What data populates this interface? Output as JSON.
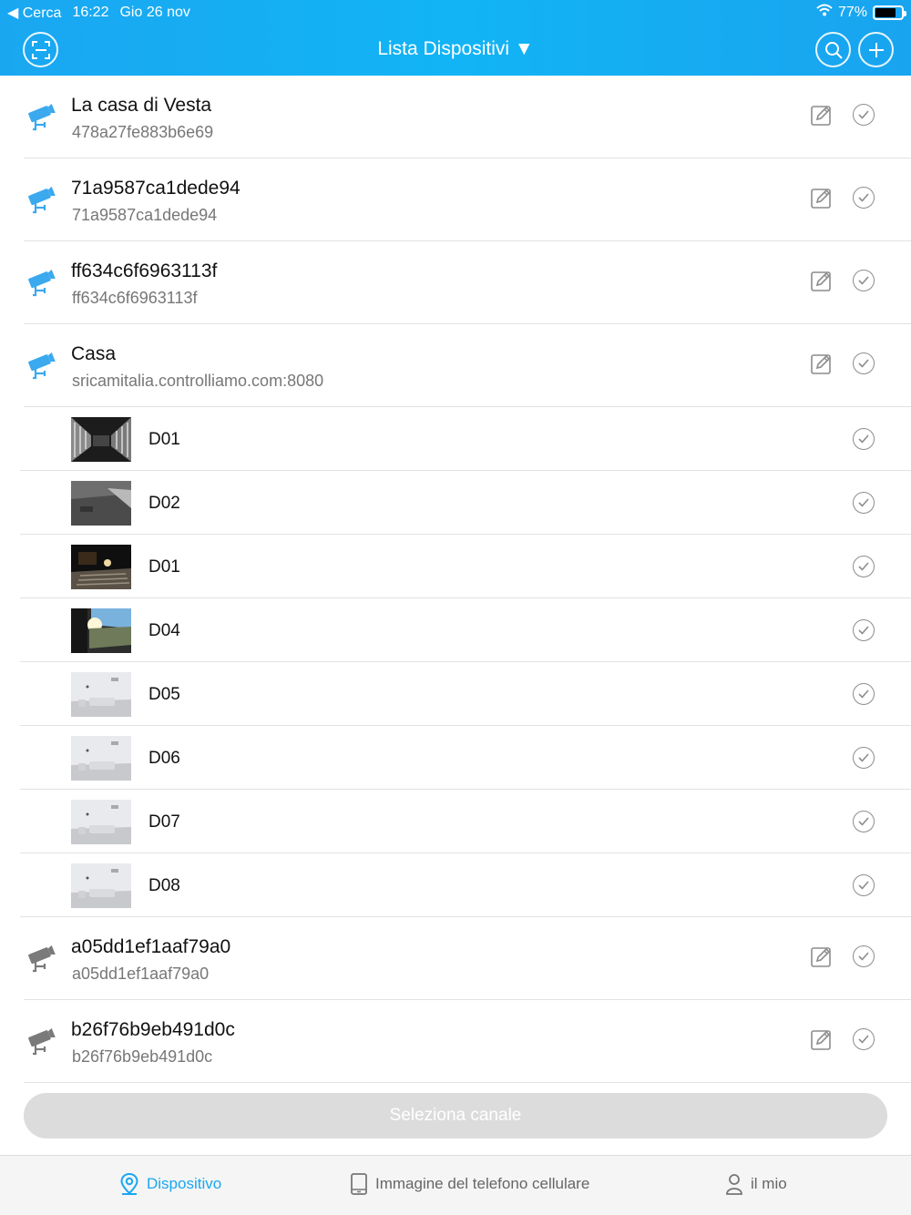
{
  "status_bar": {
    "back": "◀ Cerca",
    "time": "16:22",
    "date": "Gio 26 nov",
    "battery": "77%",
    "battery_level": 0.77
  },
  "header": {
    "title": "Lista Dispositivi ▼"
  },
  "colors": {
    "accent": "#1aa7f1",
    "online_icon": "#3aa9ee",
    "offline_icon": "#7a7a7a"
  },
  "devices": [
    {
      "name": "La casa di Vesta",
      "sub": "478a27fe883b6e69",
      "status": "online"
    },
    {
      "name": "71a9587ca1dede94",
      "sub": "71a9587ca1dede94",
      "status": "online"
    },
    {
      "name": "ff634c6f6963113f",
      "sub": "ff634c6f6963113f",
      "status": "online"
    },
    {
      "name": "Casa",
      "sub": "sricamitalia.controlliamo.com:8080",
      "status": "online"
    }
  ],
  "channels": [
    {
      "name": "D01",
      "thumb": "dark-corridor"
    },
    {
      "name": "D02",
      "thumb": "gray-room"
    },
    {
      "name": "D01",
      "thumb": "night-stairs"
    },
    {
      "name": "D04",
      "thumb": "sunlit-yard"
    },
    {
      "name": "D05",
      "thumb": "white-room"
    },
    {
      "name": "D06",
      "thumb": "white-room"
    },
    {
      "name": "D07",
      "thumb": "white-room"
    },
    {
      "name": "D08",
      "thumb": "white-room"
    }
  ],
  "devices_after": [
    {
      "name": "a05dd1ef1aaf79a0",
      "sub": "a05dd1ef1aaf79a0",
      "status": "offline"
    },
    {
      "name": "b26f76b9eb491d0c",
      "sub": "b26f76b9eb491d0c",
      "status": "offline"
    }
  ],
  "select_button": "Seleziona canale",
  "tabs": [
    {
      "label": "Dispositivo",
      "icon": "location-pin-icon",
      "active": true
    },
    {
      "label": "Immagine del telefono cellulare",
      "icon": "tablet-icon",
      "active": false
    },
    {
      "label": "il mio",
      "icon": "user-icon",
      "active": false
    }
  ]
}
